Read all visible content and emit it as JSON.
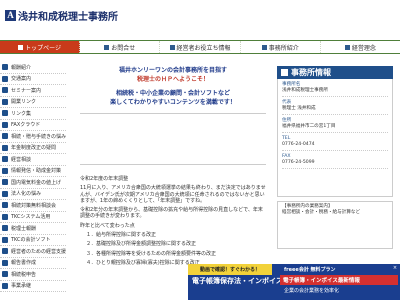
{
  "header": {
    "logo_mark": "A",
    "title": "浅井和成税理士事務所"
  },
  "nav": [
    {
      "label": "トップページ",
      "active": true
    },
    {
      "label": "お問合せ",
      "active": false
    },
    {
      "label": "経営者お役立ち情報",
      "active": false
    },
    {
      "label": "事務所紹介",
      "active": false
    },
    {
      "label": "経営理念",
      "active": false
    }
  ],
  "sidebar": [
    "報酬紹介",
    "交通案内",
    "セミナー案内",
    "開業リンク",
    "リンク集",
    "FAXクラウド",
    "相続・贈与手続きの悩み",
    "年金制度改正の疑問",
    "経営相談",
    "情報発信・助成金対策",
    "国内電気料金の値上げ",
    "法人化の悩み",
    "相続対策無料相談会",
    "TKCシステム活用",
    "税理士報酬",
    "TKCの会計ソフト",
    "経営者のための経営支援",
    "報告書作成",
    "相続税申告",
    "事業承継"
  ],
  "main": {
    "greet1": "福井ホンリーワンの会計事務所を目指す",
    "greet2": "税理士のＨＰへようこそ！",
    "greet3": "相続税・中小企業の顧問・会計ソフトなど",
    "greet4": "楽しくてわかりやすいコンテンツを満載です！",
    "p1": "令和2年度の年末調整",
    "p2": "11月に入り、アメリカ合衆国の大統領選挙の結果も終わり、まだ決定ではありませんが、バイデン氏が次期アメリカ合衆国の大統領に任命されるのではないかと思いますが、1年の締めくくりとして、「年末調整」ですね。",
    "p3": "令和2年分の年末調整から、基礎控除の拡充や給与所得控除の見直しなどで、年末調整の手続きが変わります。",
    "p4": "昨年と比べて変わった点",
    "items": [
      "１．給与所得控除に関する改正",
      "２．基礎控除及び所得金額調整控除に関する改正",
      "３．各種所得控除等を受けるための所得金額要件等の改正",
      "４．ひとり親控除及び寡婦(寡夫)控除に関する改正"
    ]
  },
  "right": {
    "title": "事務所情報",
    "office_head": "事務所名",
    "office_name": "浅井和成税理士事務所",
    "rep_head": "代表",
    "rep_name": "税理士 浅井和成",
    "addr_head": "住所",
    "addr": "福井県福井市二の宮1丁目",
    "tel_head": "TEL",
    "tel": "0776-24-0474",
    "fax_head": "FAX",
    "fax": "0776-24-5099",
    "notice_head": "【事務所内の業務案内】",
    "notice": "経営相談・会計・税務・給与計算など"
  },
  "ad": {
    "badge": "動画で確認！すぐわかる！",
    "left": "電子帳簿保存法・インボイス対応",
    "r1": "freee会計 無料プラン",
    "r2": "電子帳簿・インボイス最新情報",
    "r3": "企業の会計業務を効率化",
    "close": "×"
  }
}
